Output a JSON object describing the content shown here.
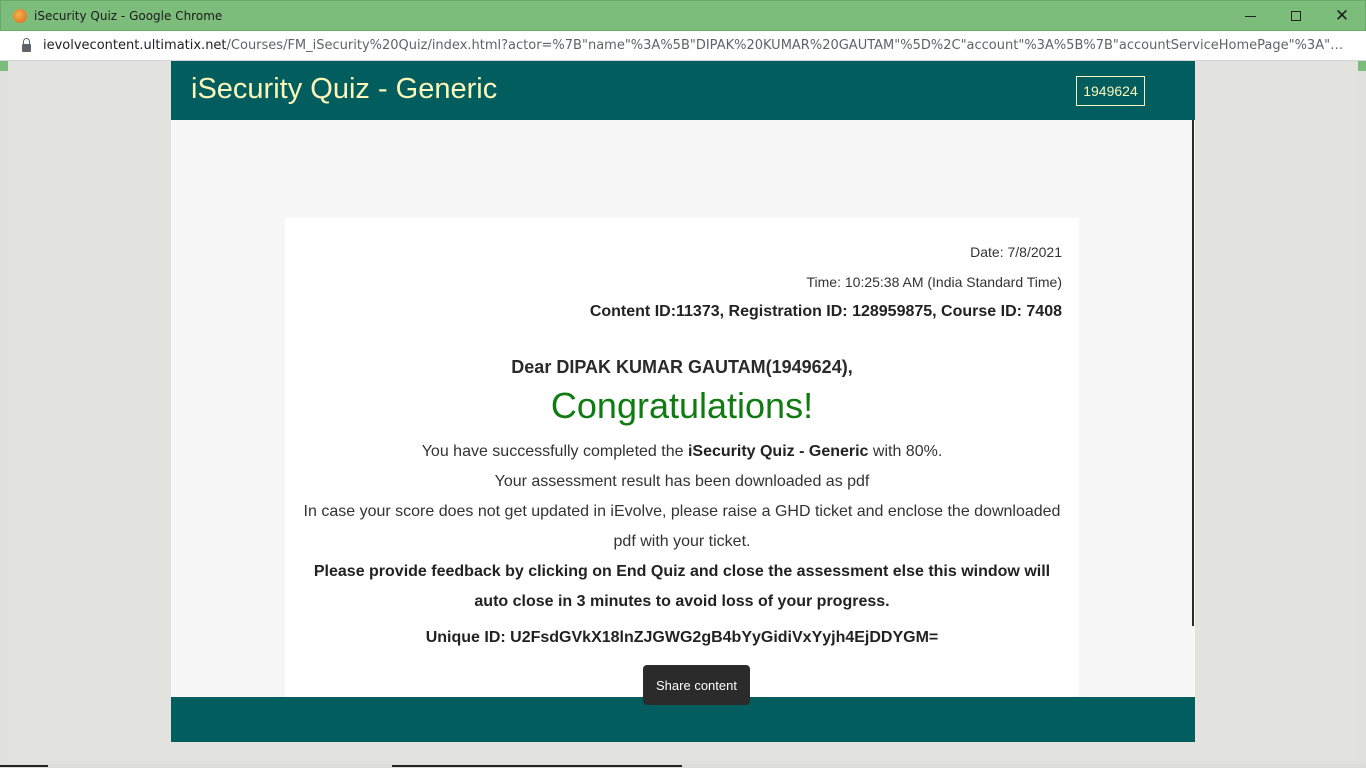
{
  "window": {
    "title": "iSecurity Quiz - Google Chrome",
    "controls": {
      "minimize_icon": "minimize-icon",
      "maximize_icon": "maximize-icon",
      "close_icon": "close-icon"
    }
  },
  "address_bar": {
    "host": "ievolvecontent.ultimatix.net",
    "path": "/Courses/FM_iSecurity%20Quiz/index.html?actor=%7B\"name\"%3A%5B\"DIPAK%20KUMAR%20GAUTAM\"%5D%2C\"account\"%3A%5B%7B\"accountServiceHomePage\"%3A\"https%3A%..."
  },
  "quiz": {
    "title": "iSecurity Quiz - Generic",
    "user_badge": "1949624",
    "date": "Date: 7/8/2021",
    "time": "Time: 10:25:38 AM (India Standard Time)",
    "ids": "Content ID:11373, Registration ID: 128959875, Course ID: 7408",
    "greeting": "Dear DIPAK KUMAR GAUTAM(1949624),",
    "congrats": "Congratulations!",
    "completed_prefix": "You have successfully completed the ",
    "quiz_name": "iSecurity Quiz - Generic",
    "completed_suffix": " with 80%.",
    "download_note": "Your assessment result has been downloaded as pdf",
    "ghd_note": "In case your score does not get updated in iEvolve, please raise a GHD ticket and enclose the downloaded pdf with your ticket.",
    "feedback_note": "Please provide feedback by clicking on End Quiz and close the assessment else this window will auto close in 3 minutes to avoid loss of your progress.",
    "unique_id": "Unique ID: U2FsdGVkX18lnZJGWG2gB4bYyGidiVxYyjh4EjDDYGM="
  },
  "tooltip": {
    "text": "Share content"
  }
}
